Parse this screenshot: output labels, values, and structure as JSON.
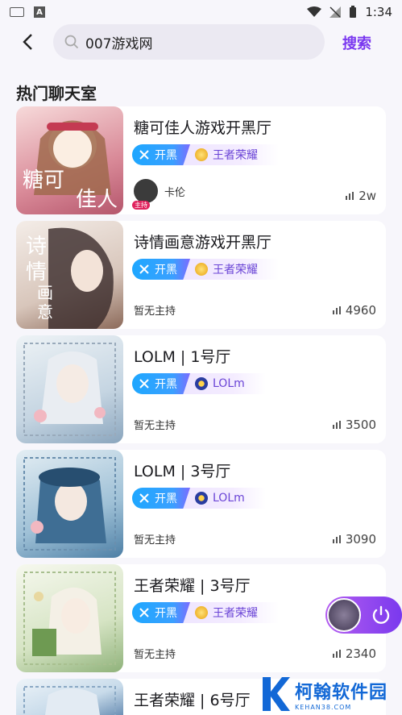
{
  "status": {
    "time": "1:34"
  },
  "search": {
    "value": "007游戏网",
    "action_label": "搜索"
  },
  "section_title": "热门聊天室",
  "rooms": [
    {
      "title": "糖可佳人游戏开黑厅",
      "tag": "开黑",
      "game": "王者荣耀",
      "host": "卡伦",
      "host_badge": "主持",
      "heat": "2w",
      "cover_text": "糖可佳人",
      "cover_colors": [
        "#f3c7c6",
        "#c7667a"
      ]
    },
    {
      "title": "诗情画意游戏开黑厅",
      "tag": "开黑",
      "game": "王者荣耀",
      "host": "暂无主持",
      "heat": "4960",
      "cover_text": "诗情画意",
      "cover_colors": [
        "#ece4dd",
        "#8c6a5a"
      ]
    },
    {
      "title": "LOLM | 1号厅",
      "tag": "开黑",
      "game": "LOLm",
      "host": "暂无主持",
      "heat": "3500",
      "cover_colors": [
        "#dfe8ef",
        "#8aa5bd"
      ]
    },
    {
      "title": "LOLM | 3号厅",
      "tag": "开黑",
      "game": "LOLm",
      "host": "暂无主持",
      "heat": "3090",
      "cover_colors": [
        "#cfe0ea",
        "#4d7fa5"
      ]
    },
    {
      "title": "王者荣耀 | 3号厅",
      "tag": "开黑",
      "game": "王者荣耀",
      "host": "暂无主持",
      "heat": "2340",
      "cover_colors": [
        "#eef2e2",
        "#8fb27a"
      ]
    },
    {
      "title": "王者荣耀 | 6号厅",
      "cover_colors": [
        "#d9e6f2",
        "#6c90b5"
      ]
    }
  ],
  "watermark": {
    "cn": "柯翰软件园",
    "en": "KEHAN38.COM"
  }
}
